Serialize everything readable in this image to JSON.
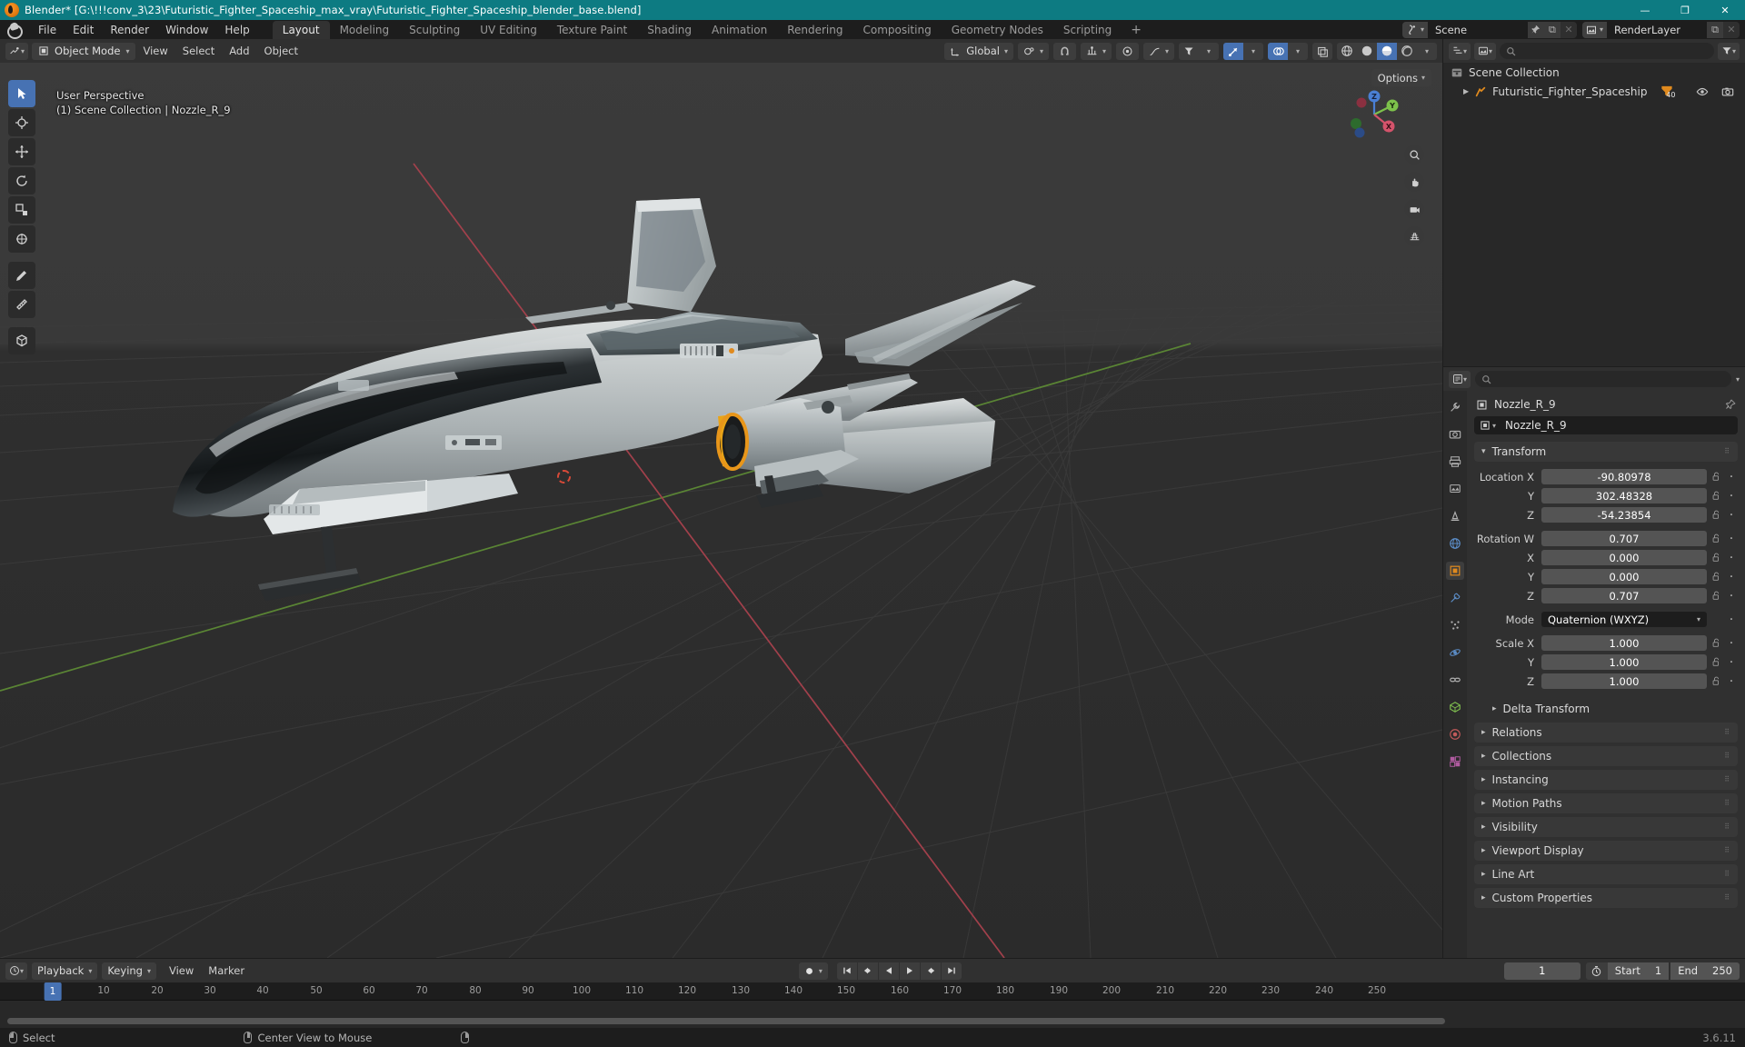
{
  "window": {
    "title": "Blender* [G:\\!!!conv_3\\23\\Futuristic_Fighter_Spaceship_max_vray\\Futuristic_Fighter_Spaceship_blender_base.blend]",
    "minimize": "—",
    "maximize": "❐",
    "close": "✕"
  },
  "topbar": {
    "menus": [
      "File",
      "Edit",
      "Render",
      "Window",
      "Help"
    ],
    "workspaces": [
      {
        "label": "Layout",
        "active": true
      },
      {
        "label": "Modeling",
        "active": false
      },
      {
        "label": "Sculpting",
        "active": false
      },
      {
        "label": "UV Editing",
        "active": false
      },
      {
        "label": "Texture Paint",
        "active": false
      },
      {
        "label": "Shading",
        "active": false
      },
      {
        "label": "Animation",
        "active": false
      },
      {
        "label": "Rendering",
        "active": false
      },
      {
        "label": "Compositing",
        "active": false
      },
      {
        "label": "Geometry Nodes",
        "active": false
      },
      {
        "label": "Scripting",
        "active": false
      }
    ],
    "add_workspace": "+",
    "scene": {
      "name": "Scene",
      "new_label": "⧉",
      "unlink_label": "✕"
    },
    "view_layer": {
      "name": "RenderLayer",
      "new_label": "⧉",
      "unlink_label": "✕"
    }
  },
  "viewport": {
    "header": {
      "mode": "Object Mode",
      "menus": [
        "View",
        "Select",
        "Add",
        "Object"
      ],
      "transform_orientation": "Global",
      "snap_label": "",
      "proportional_label": ""
    },
    "options_label": "Options",
    "overlay_line1": "User Perspective",
    "overlay_line2": "(1) Scene Collection | Nozzle_R_9",
    "gizmo_axes": {
      "z_plus": "Z",
      "y_plus": "Y",
      "x_plus": "X",
      "z_color": "#4a7fd4",
      "y_color": "#7dc24b",
      "x_color": "#d4536b"
    },
    "tools": [
      "tweak-select-tool",
      "cursor-tool",
      "move-tool",
      "rotate-tool",
      "scale-tool",
      "transform-tool",
      "annotate-tool",
      "measure-tool",
      "add-cube-tool"
    ]
  },
  "outliner": {
    "search_placeholder": "",
    "display_mode": "View Layer",
    "rows": [
      {
        "label": "Scene Collection",
        "icon": "collection-icon",
        "indent": 0
      },
      {
        "label": "Futuristic_Fighter_Spaceship",
        "icon": "armature-icon",
        "indent": 1,
        "badge": "40"
      }
    ]
  },
  "properties": {
    "search_placeholder": "",
    "breadcrumb_object": "Nozzle_R_9",
    "object_name": "Nozzle_R_9",
    "transform": {
      "title": "Transform",
      "rows": [
        {
          "label": "Location X",
          "value": "-90.80978",
          "gap": false
        },
        {
          "label": "Y",
          "value": "302.48328",
          "gap": false
        },
        {
          "label": "Z",
          "value": "-54.23854",
          "gap": false
        },
        {
          "label": "Rotation W",
          "value": "0.707",
          "gap": true
        },
        {
          "label": "X",
          "value": "0.000",
          "gap": false
        },
        {
          "label": "Y",
          "value": "0.000",
          "gap": false
        },
        {
          "label": "Z",
          "value": "0.707",
          "gap": false
        }
      ],
      "mode_label": "Mode",
      "mode_value": "Quaternion (WXYZ)",
      "scale_rows": [
        {
          "label": "Scale X",
          "value": "1.000",
          "gap": true
        },
        {
          "label": "Y",
          "value": "1.000",
          "gap": false
        },
        {
          "label": "Z",
          "value": "1.000",
          "gap": false
        }
      ]
    },
    "sub_panel": "Delta Transform",
    "panels": [
      "Relations",
      "Collections",
      "Instancing",
      "Motion Paths",
      "Visibility",
      "Viewport Display",
      "Line Art",
      "Custom Properties"
    ]
  },
  "timeline": {
    "menus": [
      "Playback",
      "Keying",
      "View",
      "Marker"
    ],
    "current_frame": "1",
    "start_label": "Start",
    "start_value": "1",
    "end_label": "End",
    "end_value": "250",
    "ticks": [
      {
        "label": "10",
        "frame": 10
      },
      {
        "label": "20",
        "frame": 20
      },
      {
        "label": "30",
        "frame": 30
      },
      {
        "label": "40",
        "frame": 40
      },
      {
        "label": "50",
        "frame": 50
      },
      {
        "label": "60",
        "frame": 60
      },
      {
        "label": "70",
        "frame": 70
      },
      {
        "label": "80",
        "frame": 80
      },
      {
        "label": "90",
        "frame": 90
      },
      {
        "label": "100",
        "frame": 100
      },
      {
        "label": "110",
        "frame": 110
      },
      {
        "label": "120",
        "frame": 120
      },
      {
        "label": "130",
        "frame": 130
      },
      {
        "label": "140",
        "frame": 140
      },
      {
        "label": "150",
        "frame": 150
      },
      {
        "label": "160",
        "frame": 160
      },
      {
        "label": "170",
        "frame": 170
      },
      {
        "label": "180",
        "frame": 180
      },
      {
        "label": "190",
        "frame": 190
      },
      {
        "label": "200",
        "frame": 200
      },
      {
        "label": "210",
        "frame": 210
      },
      {
        "label": "220",
        "frame": 220
      },
      {
        "label": "230",
        "frame": 230
      },
      {
        "label": "240",
        "frame": 240
      },
      {
        "label": "250",
        "frame": 250
      }
    ],
    "playhead_label": "1"
  },
  "statusbar": {
    "items": [
      {
        "mouse": "left",
        "label": "Select"
      },
      {
        "mouse": "middle",
        "label": "Center View to Mouse"
      },
      {
        "mouse": "right",
        "label": ""
      }
    ],
    "version": "3.6.11"
  },
  "colors": {
    "accent_blue": "#4772b3",
    "title_teal": "#0d7b82",
    "axis_red": "#b5444e",
    "axis_green": "#6b9e3f",
    "orange": "#e08a1e"
  }
}
